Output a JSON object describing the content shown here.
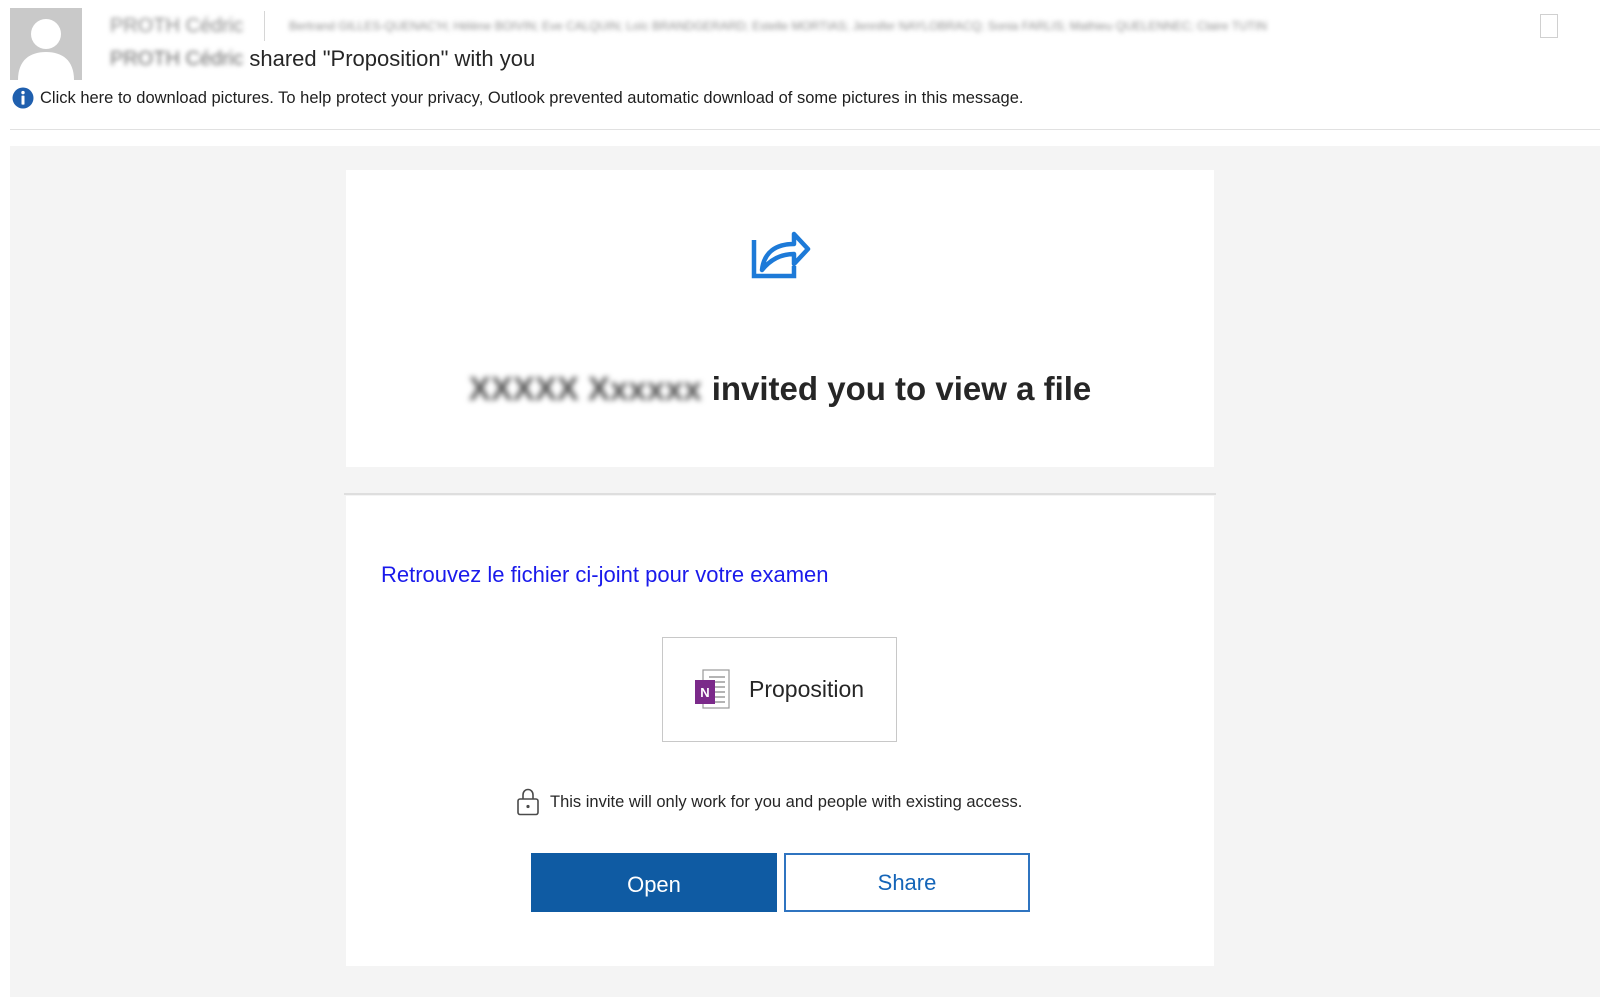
{
  "header": {
    "sender_name": "PROTH Cédric",
    "recipients": "Bertrand GILLES-QUENAC'H; Hélène BOIVIN; Eve CALQUIN; Loïc BRANDGERARD; Estelle MORTIAS; Jennifer NAYLOBRACQ; Sonia FARLIS; Mathieu QUELENNEC; Claire TUTIN",
    "subject_sender": "PROTH Cédric",
    "subject_text": "shared \"Proposition\" with you",
    "info_bar_text": "Click here to download pictures. To help protect your privacy, Outlook prevented automatic download of some pictures in this message."
  },
  "card": {
    "inviter_name": "XXXXX Xxxxxx",
    "headline_text": "invited you to view a file",
    "message_text": "Retrouvez le fichier ci-joint pour votre examen",
    "file_name": "Proposition",
    "file_icon": "onenote-icon",
    "privacy_note": "This invite will only work for you and people with existing access.",
    "open_label": "Open",
    "share_label": "Share"
  },
  "colors": {
    "accent_blue": "#0f5ba3",
    "link_blue": "#1a1aeb",
    "share_icon_blue": "#1d7ad8",
    "onenote_purple": "#7b2a8a",
    "body_background": "#f4f4f4"
  }
}
